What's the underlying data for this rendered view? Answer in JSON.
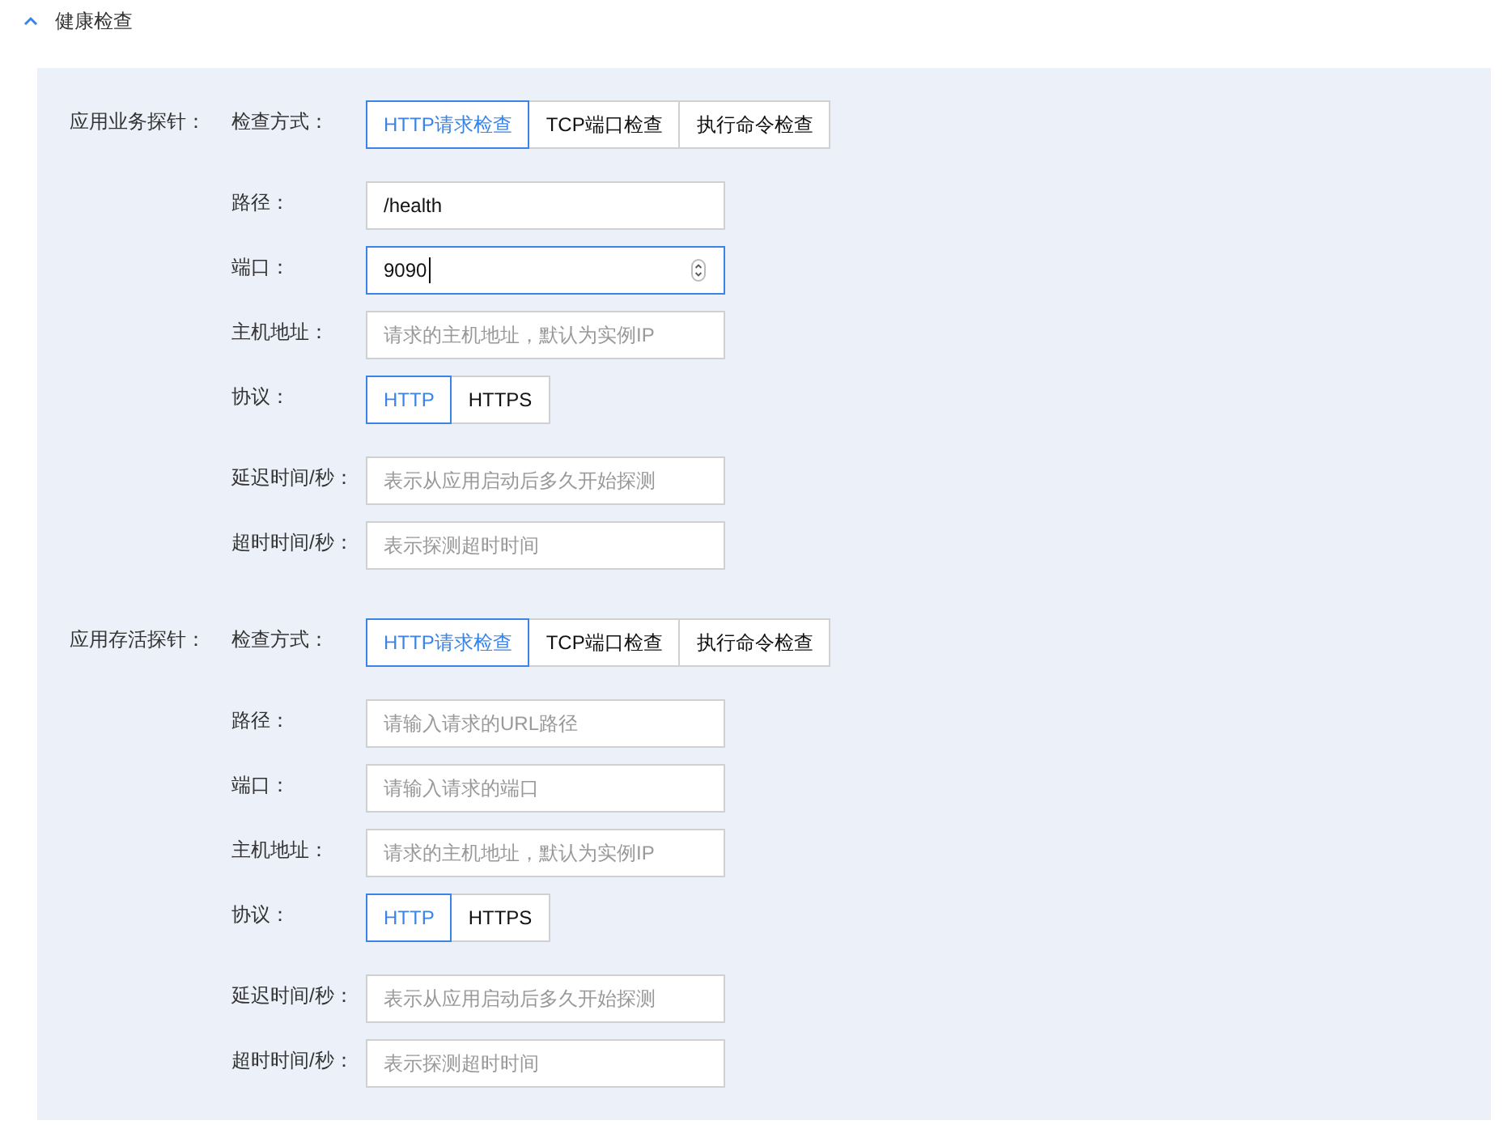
{
  "section": {
    "title": "健康检查",
    "expanded": true
  },
  "probes": [
    {
      "label": "应用业务探针：",
      "rows": [
        {
          "kind": "segmented",
          "label": "检查方式：",
          "options": [
            {
              "label": "HTTP请求检查",
              "selected": true
            },
            {
              "label": "TCP端口检查",
              "selected": false
            },
            {
              "label": "执行命令检查",
              "selected": false
            }
          ]
        },
        {
          "kind": "text",
          "label": "路径：",
          "value": "/health",
          "focused": false
        },
        {
          "kind": "number",
          "label": "端口：",
          "value": "9090",
          "focused": true
        },
        {
          "kind": "text",
          "label": "主机地址：",
          "placeholder": "请求的主机地址，默认为实例IP",
          "focused": false
        },
        {
          "kind": "segmented",
          "label": "协议：",
          "options": [
            {
              "label": "HTTP",
              "selected": true
            },
            {
              "label": "HTTPS",
              "selected": false
            }
          ]
        },
        {
          "kind": "text",
          "label": "延迟时间/秒：",
          "placeholder": "表示从应用启动后多久开始探测",
          "focused": false
        },
        {
          "kind": "text",
          "label": "超时时间/秒：",
          "placeholder": "表示探测超时时间",
          "focused": false
        }
      ]
    },
    {
      "label": "应用存活探针：",
      "rows": [
        {
          "kind": "segmented",
          "label": "检查方式：",
          "options": [
            {
              "label": "HTTP请求检查",
              "selected": true
            },
            {
              "label": "TCP端口检查",
              "selected": false
            },
            {
              "label": "执行命令检查",
              "selected": false
            }
          ]
        },
        {
          "kind": "text",
          "label": "路径：",
          "placeholder": "请输入请求的URL路径",
          "focused": false
        },
        {
          "kind": "text",
          "label": "端口：",
          "placeholder": "请输入请求的端口",
          "focused": false
        },
        {
          "kind": "text",
          "label": "主机地址：",
          "placeholder": "请求的主机地址，默认为实例IP",
          "focused": false
        },
        {
          "kind": "segmented",
          "label": "协议：",
          "options": [
            {
              "label": "HTTP",
              "selected": true
            },
            {
              "label": "HTTPS",
              "selected": false
            }
          ]
        },
        {
          "kind": "text",
          "label": "延迟时间/秒：",
          "placeholder": "表示从应用启动后多久开始探测",
          "focused": false
        },
        {
          "kind": "text",
          "label": "超时时间/秒：",
          "placeholder": "表示探测超时时间",
          "focused": false
        }
      ]
    }
  ]
}
